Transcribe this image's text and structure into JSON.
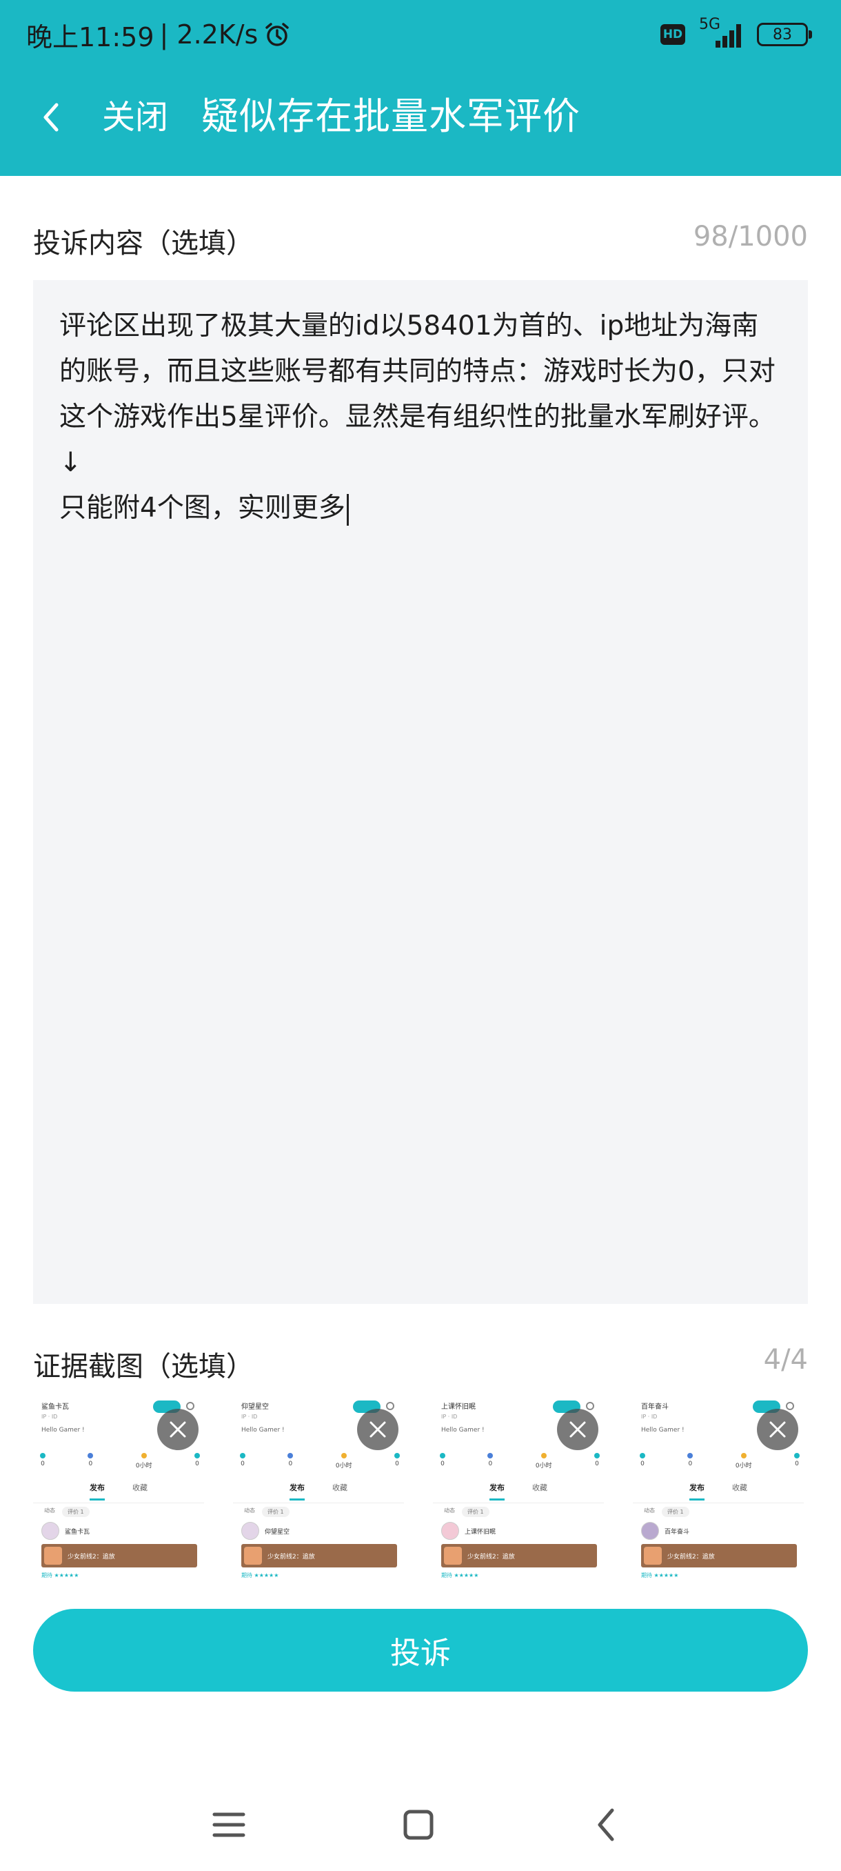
{
  "status_bar": {
    "time": "晚上11:59",
    "net_speed": "| 2.2K/s",
    "hd": "HD",
    "network": "5G",
    "battery": "83",
    "icons": [
      "alarm-icon",
      "hd-icon",
      "signal-icon",
      "battery-icon"
    ]
  },
  "header": {
    "close_label": "关闭",
    "title": "疑似存在批量水军评价",
    "background_color": "#1bb8c4"
  },
  "complaint": {
    "label": "投诉内容（选填）",
    "counter": "98/1000",
    "text": "评论区出现了极其大量的id以58401为首的、ip地址为海南的账号，而且这些账号都有共同的特点：游戏时长为0，只对这个游戏作出5星评价。显然是有组织性的批量水军刷好评。\n↓\n只能附4个图，实则更多"
  },
  "evidence": {
    "label": "证据截图（选填）",
    "counter": "4/4",
    "thumbnails": [
      {
        "name": "鲨鱼卡瓦",
        "user": "鲨鱼卡瓦"
      },
      {
        "name": "仰望星空",
        "user": "仰望星空"
      },
      {
        "name": "上课怀旧眠",
        "user": "上课怀旧眠"
      },
      {
        "name": "百年奋斗",
        "user": "百年奋斗"
      }
    ],
    "thumb_hello": "Hello Gamer !",
    "thumb_stats": [
      "0",
      "0",
      "0小时",
      "0"
    ],
    "thumb_tabs": [
      "发布",
      "收藏"
    ],
    "thumb_chips": [
      "动态",
      "评价 1"
    ],
    "thumb_game": "少女前线2：追放",
    "thumb_rating": "期待 ★★★★★"
  },
  "submit": {
    "label": "投诉",
    "color": "#19c4cf"
  },
  "nav": {
    "icons": [
      "menu-icon",
      "home-icon",
      "back-icon"
    ]
  }
}
